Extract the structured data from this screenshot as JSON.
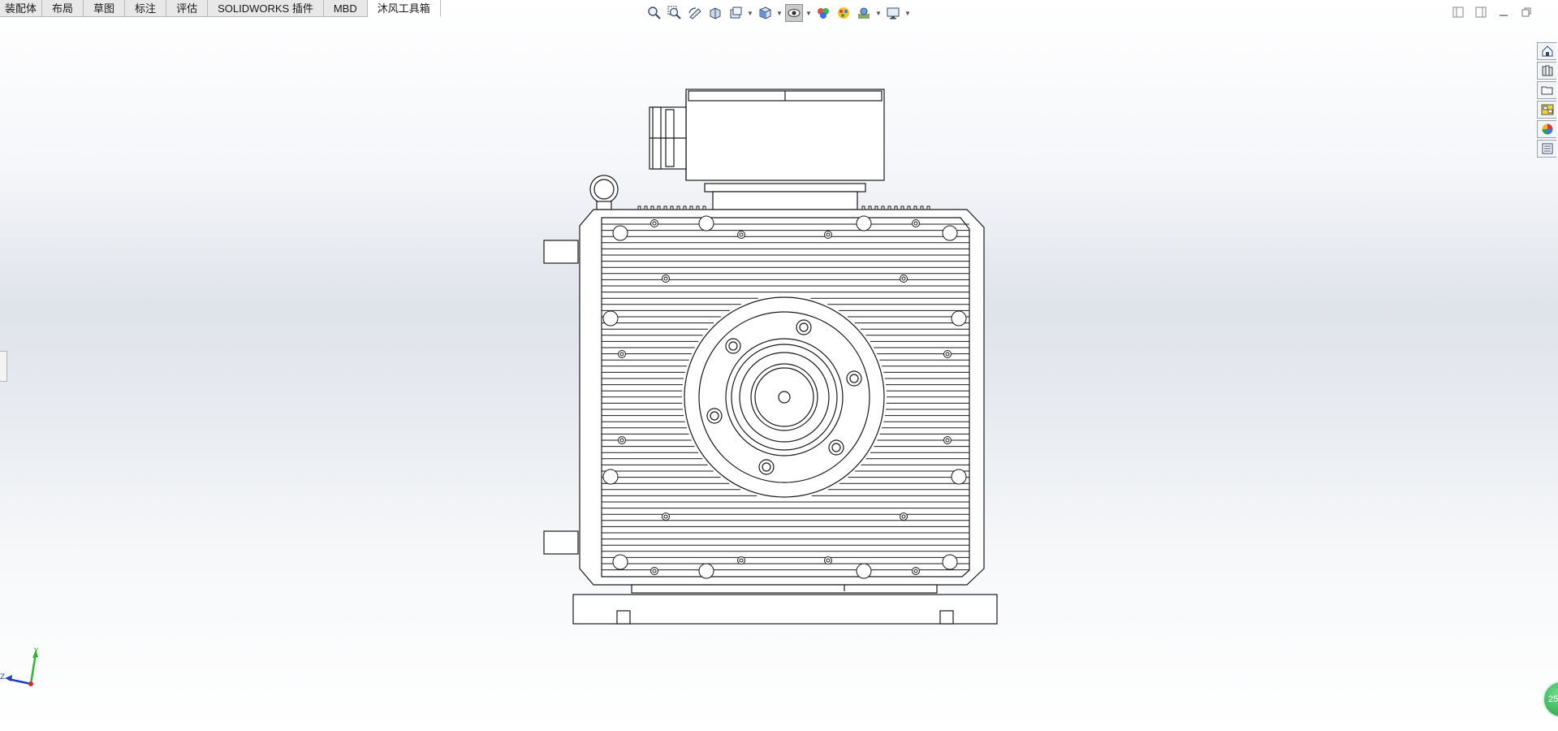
{
  "command_tabs": [
    {
      "label": "装配体",
      "active": false
    },
    {
      "label": "布局",
      "active": false
    },
    {
      "label": "草图",
      "active": false
    },
    {
      "label": "标注",
      "active": false
    },
    {
      "label": "评估",
      "active": false
    },
    {
      "label": "SOLIDWORKS 插件",
      "active": false
    },
    {
      "label": "MBD",
      "active": false
    },
    {
      "label": "沐风工具箱",
      "active": true
    }
  ],
  "heads_up_toolbar": [
    "zoom-to-fit-icon",
    "zoom-to-area-icon",
    "previous-view-icon",
    "section-view-icon",
    "dynamic-annotation-views-icon",
    "view-orientation-icon",
    "display-style-icon",
    "hide-show-items-icon",
    "edit-appearance-icon",
    "apply-scene-icon",
    "view-settings-icon"
  ],
  "window_controls": [
    "tile-left-icon",
    "tile-right-icon",
    "minimize-icon",
    "restore-icon"
  ],
  "task_pane": [
    "solidworks-resources-icon",
    "design-library-icon",
    "file-explorer-icon",
    "view-palette-icon",
    "appearances-scenes-icon",
    "custom-properties-icon"
  ],
  "triad": {
    "y_label": "Y",
    "z_label": "Z"
  },
  "status_badge": {
    "text": "25"
  },
  "colors": {
    "line": "#1a1a1a",
    "accent_green": "#2aa84f",
    "triad_y": "#2db52d",
    "triad_z": "#1f3fbf",
    "triad_x": "#d62a2a"
  }
}
